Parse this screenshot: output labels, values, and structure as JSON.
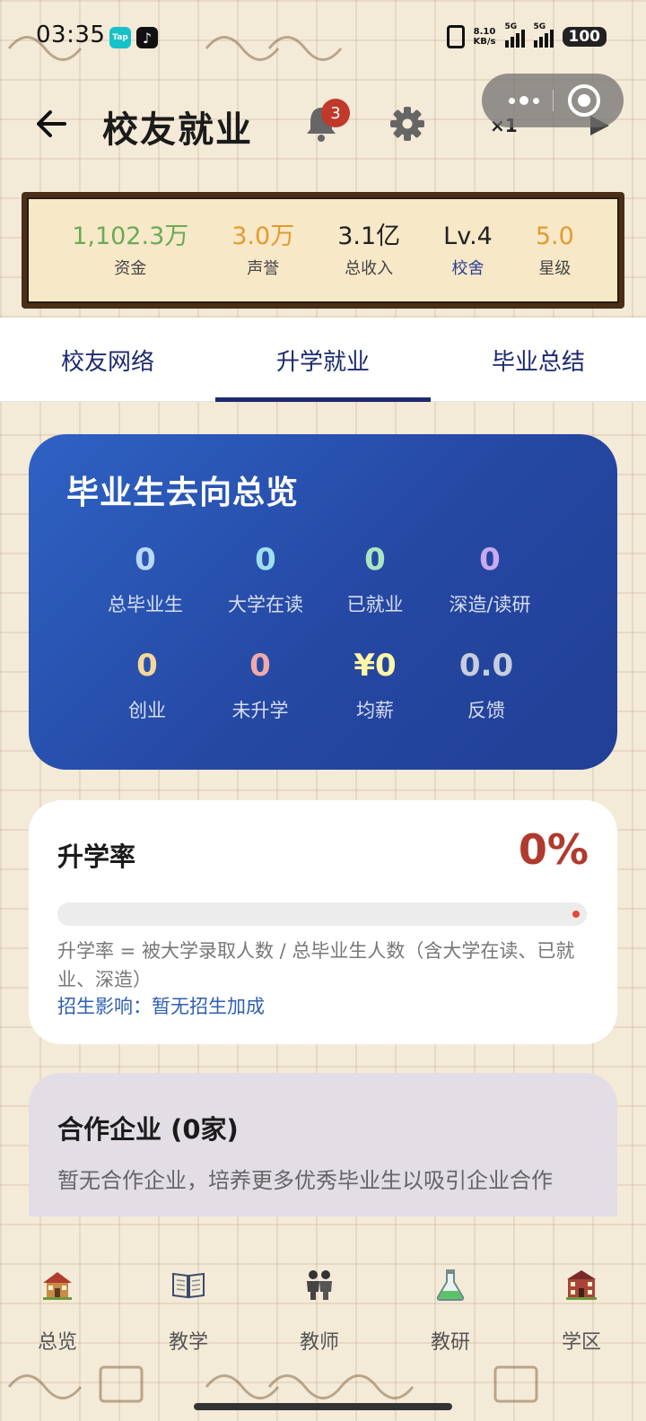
{
  "status_bar": {
    "time": "03:35",
    "app_badges": [
      "Tap",
      "♪"
    ],
    "net_speed_value": "8.10",
    "net_speed_unit": "KB/s",
    "signal1_label": "5G",
    "signal2_label": "5G",
    "battery": "100"
  },
  "header": {
    "title": "校友就业",
    "notification_count": "3",
    "speed": "×1"
  },
  "stats": [
    {
      "value": "1,102.3万",
      "label": "资金"
    },
    {
      "value": "3.0万",
      "label": "声誉"
    },
    {
      "value": "3.1亿",
      "label": "总收入"
    },
    {
      "value": "Lv.4",
      "label": "校舍"
    },
    {
      "value": "5.0",
      "label": "星级"
    }
  ],
  "tabs": [
    {
      "label": "校友网络"
    },
    {
      "label": "升学就业"
    },
    {
      "label": "毕业总结"
    }
  ],
  "active_tab": 1,
  "overview": {
    "title": "毕业生去向总览",
    "items": [
      {
        "value": "0",
        "label": "总毕业生",
        "color": "#b9d9f7"
      },
      {
        "value": "0",
        "label": "大学在读",
        "color": "#9fe0f0"
      },
      {
        "value": "0",
        "label": "已就业",
        "color": "#a9e6c1"
      },
      {
        "value": "0",
        "label": "深造/读研",
        "color": "#c9a9ef"
      },
      {
        "value": "0",
        "label": "创业",
        "color": "#f6d79a"
      },
      {
        "value": "0",
        "label": "未升学",
        "color": "#f2a9a9"
      },
      {
        "value": "¥0",
        "label": "均薪",
        "color": "#fff6a6"
      },
      {
        "value": "0.0",
        "label": "反馈",
        "color": "#c6cedd"
      }
    ]
  },
  "rate_card": {
    "title": "升学率",
    "value": "0%",
    "progress": 0,
    "formula": "升学率 = 被大学录取人数 / 总毕业生人数（含大学在读、已就业、深造）",
    "impact": "招生影响：暂无招生加成"
  },
  "partner_card": {
    "title": "合作企业 (0家)",
    "description": "暂无合作企业，培养更多优秀毕业生以吸引企业合作"
  },
  "bottom_nav": [
    {
      "label": "总览",
      "icon": "school-house-icon"
    },
    {
      "label": "教学",
      "icon": "open-book-icon"
    },
    {
      "label": "教师",
      "icon": "teachers-icon"
    },
    {
      "label": "教研",
      "icon": "flask-icon"
    },
    {
      "label": "学区",
      "icon": "school-district-icon"
    }
  ],
  "colors": {
    "accent_navy": "#1c2a6e",
    "card_blue": "#2548a3",
    "rate_red": "#b03a2e",
    "money_green": "#6aaa55",
    "gold": "#e59a2c"
  }
}
